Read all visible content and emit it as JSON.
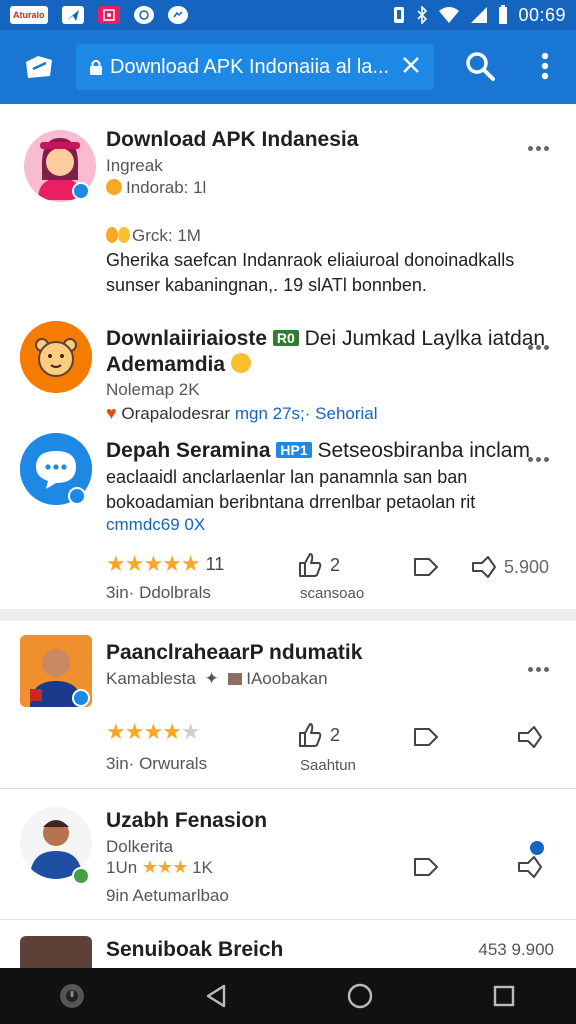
{
  "status_bar": {
    "chips": [
      "Aturalo",
      "",
      "",
      "",
      ""
    ],
    "time": "00:69"
  },
  "app_bar": {
    "url": "Download APK Indonaiia al la..."
  },
  "posts": [
    {
      "title": "Download APK Indanesia",
      "subtitle": "Ingreak",
      "meta": "Indorab: 1l",
      "meta2": "Grck: 1M",
      "body": [
        "Gherika saefcan Indanraok eliaiuroal donoinadkalls",
        "sunser kabaningnan,. 19 slATl bonnben."
      ]
    },
    {
      "title": "Downlaiiriaioste",
      "tag": "R0",
      "title_rest": "Dei Jumkad Laylka iatdan",
      "title_line2": "Ademamdia",
      "subtitle": "Nolemap 2K",
      "meta": "Orapalodesrar",
      "meta_link1": "mgn 27s;·",
      "meta_link2": "Sehorial"
    },
    {
      "title": "Depah Seramina",
      "tag": "HP1",
      "title_rest": "Setseosbiranba inclam",
      "body": [
        "eaclaaidl anclarlaenlar lan panamnla san ban",
        "bokoadamian beribntana drrenlbar petaolan rit"
      ],
      "link": "cmmdc69 0X",
      "rating_count": "11",
      "rating_label": "3in· Ddolbrals",
      "like_count": "2",
      "like_label": "scansoao",
      "share_count": "5.900"
    },
    {
      "title": "PaanclraheaarP ndumatik",
      "subtitle": "Kamablesta",
      "subtitle2": "IAoobakan",
      "rating_label": "3in· Orwurals",
      "like_count": "2",
      "like_label": "Saahtun"
    },
    {
      "title": "Uzabh Fenasion",
      "subtitle": "Dolkerita",
      "rating_prefix": "1Un",
      "rating_count": "1K",
      "rating_label": "9in  Aetumarlbao"
    },
    {
      "title": "Senuiboak Breich",
      "count": "453 9.900"
    }
  ],
  "colors": {
    "primary": "#1976d2",
    "status": "#1565c0",
    "star": "#f9a825"
  }
}
